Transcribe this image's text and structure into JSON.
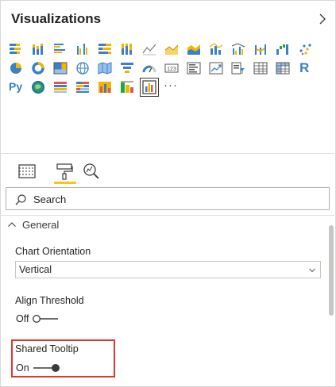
{
  "panel": {
    "title": "Visualizations"
  },
  "icons": [
    {
      "name": "stacked-bar-chart-icon"
    },
    {
      "name": "stacked-column-chart-icon"
    },
    {
      "name": "clustered-bar-chart-icon"
    },
    {
      "name": "clustered-column-chart-icon"
    },
    {
      "name": "100-stacked-bar-chart-icon"
    },
    {
      "name": "100-stacked-column-chart-icon"
    },
    {
      "name": "line-chart-icon"
    },
    {
      "name": "area-chart-icon"
    },
    {
      "name": "stacked-area-chart-icon"
    },
    {
      "name": "line-and-stacked-column-chart-icon"
    },
    {
      "name": "line-and-clustered-column-chart-icon"
    },
    {
      "name": "ribbon-chart-icon"
    },
    {
      "name": "waterfall-chart-icon"
    },
    {
      "name": "scatter-chart-icon"
    },
    {
      "name": "pie-chart-icon"
    },
    {
      "name": "donut-chart-icon"
    },
    {
      "name": "treemap-icon"
    },
    {
      "name": "map-icon"
    },
    {
      "name": "filled-map-icon"
    },
    {
      "name": "funnel-icon"
    },
    {
      "name": "gauge-icon"
    },
    {
      "name": "card-icon"
    },
    {
      "name": "multi-row-card-icon"
    },
    {
      "name": "kpi-icon"
    },
    {
      "name": "slicer-icon"
    },
    {
      "name": "table-icon"
    },
    {
      "name": "matrix-icon"
    },
    {
      "name": "r-script-visual-icon"
    },
    {
      "name": "python-visual-icon"
    },
    {
      "name": "arcgis-map-icon"
    },
    {
      "name": "custom-visual-icon-1"
    },
    {
      "name": "custom-visual-icon-2"
    },
    {
      "name": "custom-visual-icon-3"
    },
    {
      "name": "custom-visual-icon-4"
    },
    {
      "name": "custom-visual-icon-5"
    },
    {
      "name": "selected-visual-icon"
    }
  ],
  "icon_text": {
    "r": "R",
    "python": "Py",
    "more": "···"
  },
  "tabs": [
    {
      "name": "fields-tab-icon"
    },
    {
      "name": "format-tab-icon"
    },
    {
      "name": "analytics-tab-icon"
    }
  ],
  "search": {
    "placeholder": "Search"
  },
  "section": {
    "title": "General"
  },
  "chart_orientation": {
    "label": "Chart Orientation",
    "value": "Vertical"
  },
  "align_threshold": {
    "label": "Align Threshold",
    "state": "Off"
  },
  "shared_tooltip": {
    "label": "Shared Tooltip",
    "state": "On"
  },
  "colors": {
    "accent_yellow": "#f2c811",
    "highlight_red": "#e0362b",
    "icon_blue": "#3a7fc8",
    "icon_yellow": "#f2b600"
  }
}
